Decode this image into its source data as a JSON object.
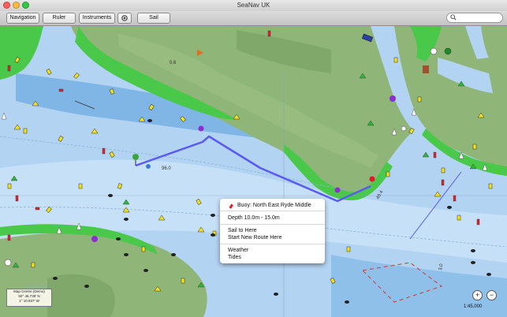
{
  "window": {
    "title": "SeaNav UK"
  },
  "toolbar": {
    "navigation_label": "Navigation",
    "ruler_label": "Ruler",
    "instruments_label": "Instruments",
    "sail_label": "Sail",
    "search_value": ""
  },
  "map": {
    "depth_labels": [
      "0.6",
      "96.0",
      "49.4",
      "3.0"
    ],
    "route_color": "#5a5af5",
    "water_color": "#b2d3f2",
    "land_color": "#90b578"
  },
  "popup": {
    "title": "Buoy: North East Ryde Middle",
    "depth": "Depth 10.0m - 15.0m",
    "sail_to_here": "Sail to Here",
    "start_new_route": "Start New Route Here",
    "weather": "Weather",
    "tides": "Tides"
  },
  "map_centre": {
    "label": "Map Centre (Demo)",
    "lat": "50° 46.739' N",
    "lon": "1° 10.937' W"
  },
  "zoom": {
    "in_label": "+",
    "out_label": "−"
  },
  "scale": {
    "text": "1:45,000"
  }
}
